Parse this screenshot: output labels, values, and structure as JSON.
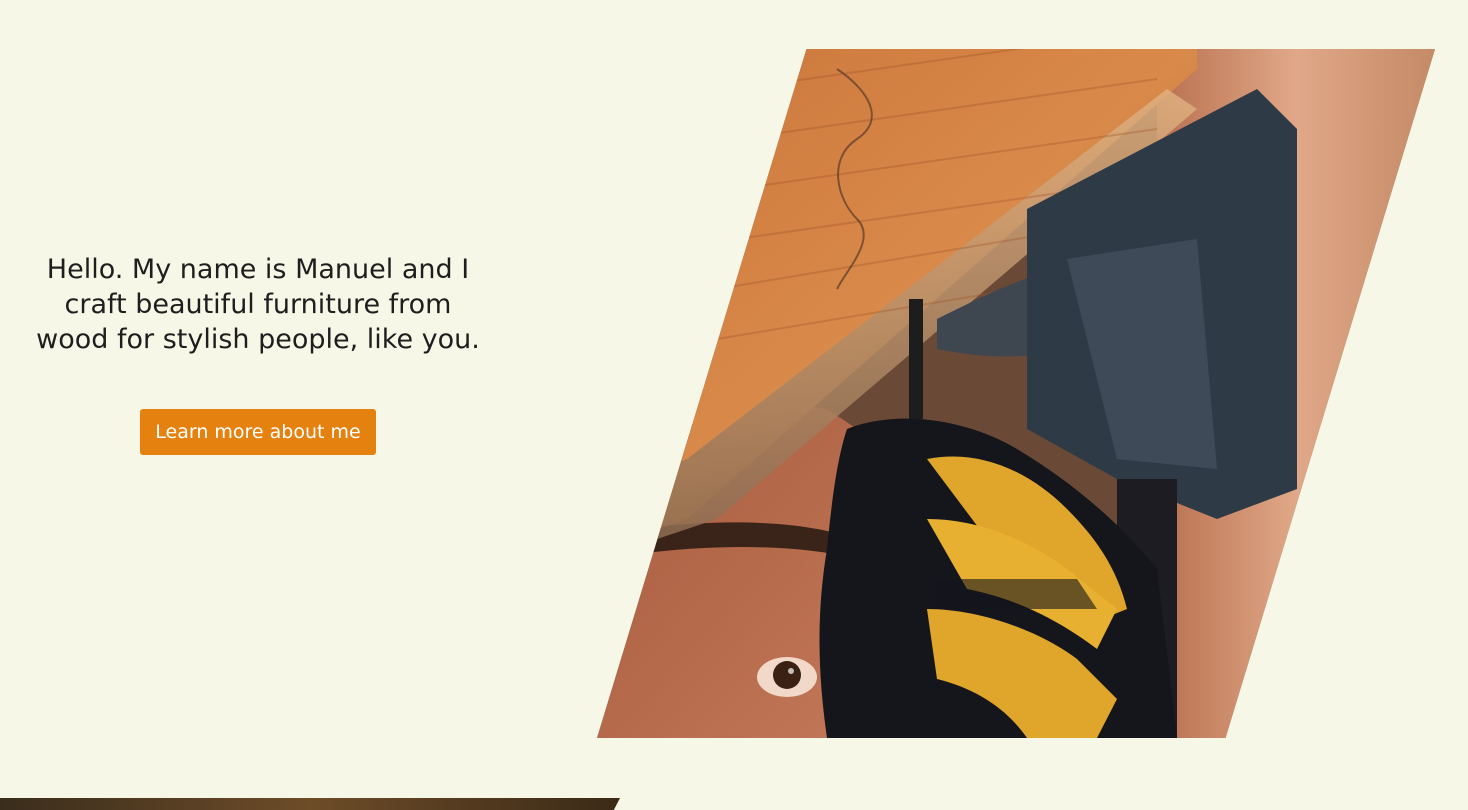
{
  "intro": {
    "text": "Hello. My name is Manuel and I craft beautiful furniture from wood for stylish people, like you.",
    "button_label": "Learn more about me"
  },
  "hero_image": {
    "description_icon": "craftsman-sawing-wood-photo"
  },
  "colors": {
    "background": "#f7f7e8",
    "accent": "#e5820f",
    "text": "#1e1e1e"
  }
}
